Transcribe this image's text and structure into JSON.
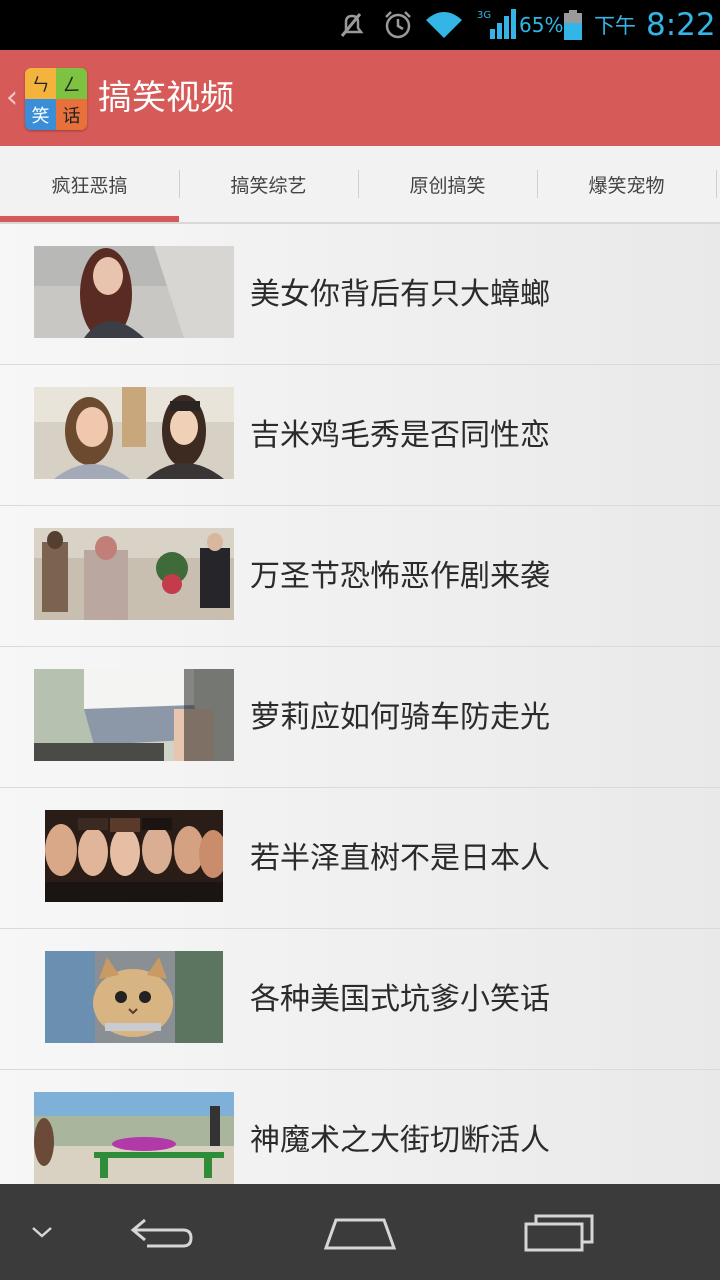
{
  "status_bar": {
    "battery_percent": "65%",
    "ampm": "下午",
    "time": "8:22",
    "network": "3G",
    "icons": [
      "mute-icon",
      "alarm-icon",
      "wifi-icon",
      "signal-icon",
      "battery-icon"
    ],
    "color": "#33b5e5"
  },
  "header": {
    "title": "搞笑视频",
    "logo_chars": [
      "ㄣ",
      "ㄥ",
      "笑",
      "话"
    ],
    "bg_color": "#d65a57"
  },
  "tabs": [
    {
      "label": "疯狂恶搞",
      "selected": true
    },
    {
      "label": "搞笑综艺",
      "selected": false
    },
    {
      "label": "原创搞笑",
      "selected": false
    },
    {
      "label": "爆笑宠物",
      "selected": false
    }
  ],
  "videos": [
    {
      "title": "美女你背后有只大蟑螂",
      "thumb": "girl-street-thumbnail"
    },
    {
      "title": "吉米鸡毛秀是否同性恋",
      "thumb": "two-women-street-thumbnail"
    },
    {
      "title": "万圣节恐怖恶作剧来袭",
      "thumb": "zombies-street-thumbnail"
    },
    {
      "title": "萝莉应如何骑车防走光",
      "thumb": "bike-skirt-thumbnail"
    },
    {
      "title": "若半泽直树不是日本人",
      "thumb": "drama-cast-thumbnail"
    },
    {
      "title": "各种美国式坑爹小笑话",
      "thumb": "cat-face-thumbnail"
    },
    {
      "title": "神魔术之大街切断活人",
      "thumb": "magic-trick-thumbnail"
    }
  ],
  "nav_bar": {
    "icons": [
      "chevron-down-icon",
      "back-icon",
      "home-icon",
      "recents-icon"
    ]
  }
}
